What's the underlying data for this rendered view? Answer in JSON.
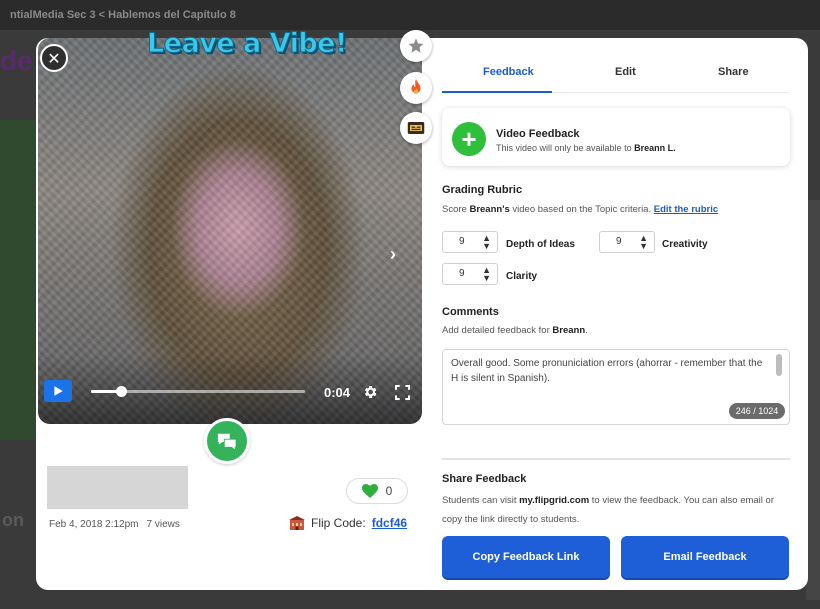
{
  "background": {
    "breadcrumb": "ntialMedia Sec 3 < Hablemos del Capítulo 8",
    "left_fragment_top": "de",
    "left_fragment_bottom": "on"
  },
  "video": {
    "overlay_title": "Leave a Vibe!",
    "time": "0:04",
    "progress_fraction": 0.14,
    "icons": {
      "close": "close-icon",
      "star": "star-icon",
      "flame": "flame-icon",
      "caption": "caption-icon",
      "next": "chevron-right-icon",
      "play": "play-icon",
      "settings": "gear-icon",
      "fullscreen": "fullscreen-icon",
      "chat": "chat-bubbles-icon"
    }
  },
  "info": {
    "date": "Feb 4, 2018 2:12pm",
    "views": "7 views",
    "likes": "0",
    "flip_code_label": "Flip Code:",
    "flip_code": "fdcf46"
  },
  "tabs": [
    {
      "label": "Feedback",
      "active": true
    },
    {
      "label": "Edit",
      "active": false
    },
    {
      "label": "Share",
      "active": false
    }
  ],
  "video_feedback": {
    "title": "Video Feedback",
    "subtitle_prefix": "This video will only be available to",
    "subtitle_name": "Breann L."
  },
  "rubric": {
    "title": "Grading Rubric",
    "text_prefix": "Score",
    "text_name": "Breann's",
    "text_suffix": "video based on the Topic criteria.",
    "edit_link": "Edit the rubric",
    "criteria": [
      {
        "value": "9",
        "label": "Depth of Ideas"
      },
      {
        "value": "9",
        "label": "Creativity"
      },
      {
        "value": "9",
        "label": "Clarity"
      }
    ]
  },
  "comments": {
    "title": "Comments",
    "text_prefix": "Add detailed feedback for",
    "text_name": "Breann",
    "value": "Overall good. Some pronuniciation errors (ahorrar - remember that the H is silent in Spanish).",
    "char_count": "246 / 1024"
  },
  "share": {
    "title": "Share Feedback",
    "text_prefix": "Students can visit",
    "text_site": "my.flipgrid.com",
    "text_suffix": "to view the feedback. You can also email or copy the link directly to students.",
    "copy_button": "Copy Feedback Link",
    "email_button": "Email Feedback"
  },
  "colors": {
    "accent": "#1e5fd8",
    "green": "#34b35a",
    "like_heart": "#2fae3f"
  }
}
